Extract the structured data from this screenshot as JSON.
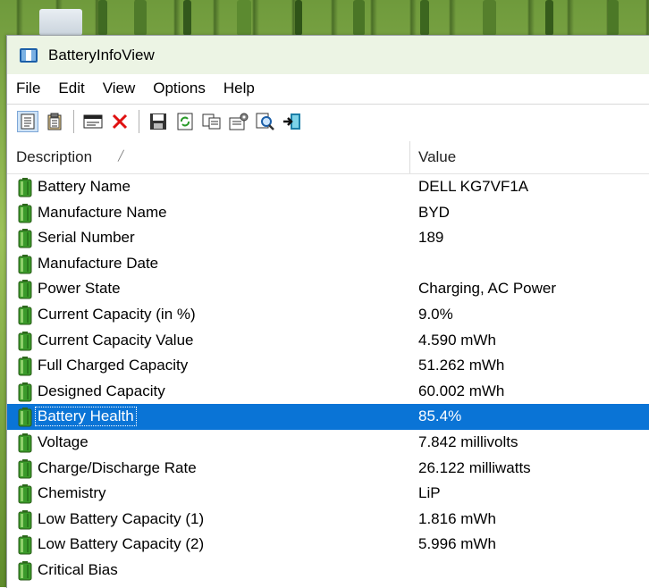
{
  "window": {
    "title": "BatteryInfoView"
  },
  "menu": [
    "File",
    "Edit",
    "View",
    "Options",
    "Help"
  ],
  "toolbar": [
    {
      "icon": "properties-icon",
      "active": true
    },
    {
      "icon": "clipboard-icon",
      "active": false
    },
    {
      "icon": "separator"
    },
    {
      "icon": "window-icon",
      "active": false
    },
    {
      "icon": "delete-icon",
      "active": false
    },
    {
      "icon": "separator"
    },
    {
      "icon": "save-icon",
      "active": false
    },
    {
      "icon": "refresh-icon",
      "active": false
    },
    {
      "icon": "copy-icon",
      "active": false
    },
    {
      "icon": "options-icon",
      "active": false
    },
    {
      "icon": "find-icon",
      "active": false
    },
    {
      "icon": "exit-icon",
      "active": false
    }
  ],
  "columns": {
    "description": "Description",
    "value": "Value"
  },
  "rows": [
    {
      "description": "Battery Name",
      "value": "DELL KG7VF1A"
    },
    {
      "description": "Manufacture Name",
      "value": "BYD"
    },
    {
      "description": "Serial Number",
      "value": "189"
    },
    {
      "description": "Manufacture Date",
      "value": ""
    },
    {
      "description": "Power State",
      "value": "Charging, AC Power"
    },
    {
      "description": "Current Capacity (in %)",
      "value": "9.0%"
    },
    {
      "description": "Current Capacity Value",
      "value": "4.590 mWh"
    },
    {
      "description": "Full Charged Capacity",
      "value": "51.262 mWh"
    },
    {
      "description": "Designed Capacity",
      "value": "60.002 mWh"
    },
    {
      "description": "Battery Health",
      "value": "85.4%",
      "selected": true
    },
    {
      "description": "Voltage",
      "value": "7.842 millivolts"
    },
    {
      "description": "Charge/Discharge Rate",
      "value": "26.122 milliwatts"
    },
    {
      "description": "Chemistry",
      "value": "LiP"
    },
    {
      "description": "Low Battery Capacity (1)",
      "value": "1.816 mWh"
    },
    {
      "description": "Low Battery Capacity (2)",
      "value": "5.996 mWh"
    },
    {
      "description": "Critical Bias",
      "value": ""
    }
  ],
  "colors": {
    "selection": "#0a74d6",
    "titlebar": "#ecf4e4",
    "battery_green": "#3a9a2a"
  }
}
